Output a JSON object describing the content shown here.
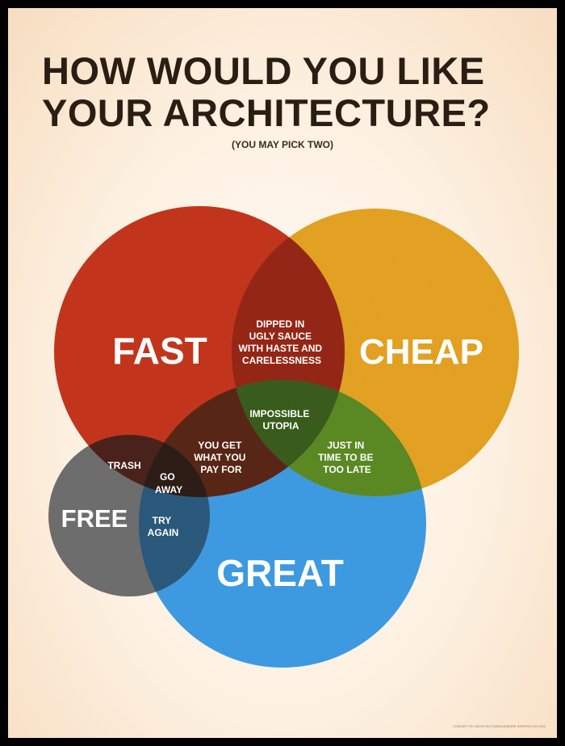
{
  "poster": {
    "title_line1": "HOW WOULD YOU LIKE",
    "title_line2": "YOUR ARCHITECTURE?",
    "subtitle": "(YOU MAY PICK TWO)",
    "footer": "CONCEPT BY ARCHITECTUREANDMORE INSPIRATION 2012"
  },
  "circles": {
    "fast": {
      "label": "FAST",
      "color": "#c4361b"
    },
    "cheap": {
      "label": "CHEAP",
      "color": "#e5a321"
    },
    "free": {
      "label": "FREE",
      "color": "#6f6e6e"
    },
    "great": {
      "label": "GREAT",
      "color": "#3f9be3"
    }
  },
  "intersections": {
    "fast_cheap": [
      "DIPPED IN",
      "UGLY SAUCE",
      "WITH HASTE AND",
      "CARELESSNESS"
    ],
    "fast_cheap_great": [
      "IMPOSSIBLE",
      "UTOPIA"
    ],
    "fast_great": [
      "YOU GET",
      "WHAT YOU",
      "PAY FOR"
    ],
    "cheap_great": [
      "JUST IN",
      "TIME TO BE",
      "TOO LATE"
    ],
    "fast_free": [
      "TRASH"
    ],
    "fast_free_great": [
      "GO",
      "AWAY"
    ],
    "free_great": [
      "TRY",
      "AGAIN"
    ]
  }
}
